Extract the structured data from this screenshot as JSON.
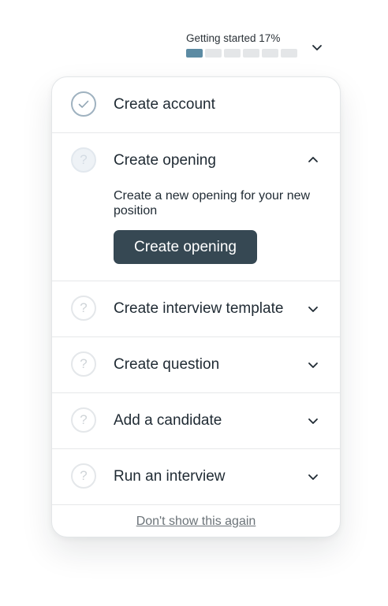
{
  "progress": {
    "title": "Getting started 17%",
    "percent": 17,
    "segments_total": 6,
    "segments_done": 1,
    "accent_color": "#5c8ba3",
    "toggle_icon": "chevron-down-icon"
  },
  "steps": [
    {
      "label": "Create account",
      "status": "done",
      "icon": "check-circle-icon",
      "expanded": false
    },
    {
      "label": "Create opening",
      "status": "active",
      "icon": "question-circle-icon",
      "expanded": true,
      "description": "Create a new opening for your new position",
      "action_label": "Create opening"
    },
    {
      "label": "Create interview template",
      "status": "pending",
      "icon": "question-circle-icon",
      "expanded": false
    },
    {
      "label": "Create question",
      "status": "pending",
      "icon": "question-circle-icon",
      "expanded": false
    },
    {
      "label": "Add a candidate",
      "status": "pending",
      "icon": "question-circle-icon",
      "expanded": false
    },
    {
      "label": "Run an interview",
      "status": "pending",
      "icon": "question-circle-icon",
      "expanded": false
    }
  ],
  "icon_glyphs": {
    "question": "?"
  },
  "footer": {
    "dismiss_label": "Don't show this again"
  },
  "colors": {
    "button_bg": "#364853",
    "text": "#1f2a33"
  }
}
